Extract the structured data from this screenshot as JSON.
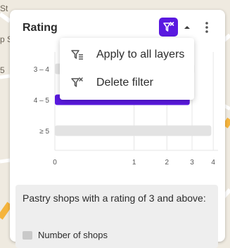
{
  "map": {
    "labels": [
      "St",
      "p S",
      "5"
    ]
  },
  "widget": {
    "title": "Rating",
    "menu": {
      "items": [
        {
          "label": "Apply to all layers",
          "icon": "filter-layers-icon"
        },
        {
          "label": "Delete filter",
          "icon": "filter-delete-icon"
        }
      ]
    },
    "description": "Pastry shops with a rating of 3 and above:",
    "legend_label": "Number of shops"
  },
  "colors": {
    "accent": "#5a19e0",
    "bar_inactive": "#e3e3e3",
    "map_bg": "#efeae0"
  },
  "chart_data": {
    "type": "bar",
    "orientation": "horizontal",
    "categories": [
      "3 – 4",
      "4 – 5",
      "≥ 5"
    ],
    "values": [
      3.1,
      2.9,
      3.9
    ],
    "highlighted": [
      false,
      true,
      false
    ],
    "x_ticks": [
      "0",
      "1",
      "2",
      "3",
      "4"
    ],
    "x_tick_values": [
      0,
      1,
      2,
      3,
      4
    ],
    "xlim": [
      0,
      4.1
    ],
    "scale": "sqrt",
    "grid": true
  }
}
